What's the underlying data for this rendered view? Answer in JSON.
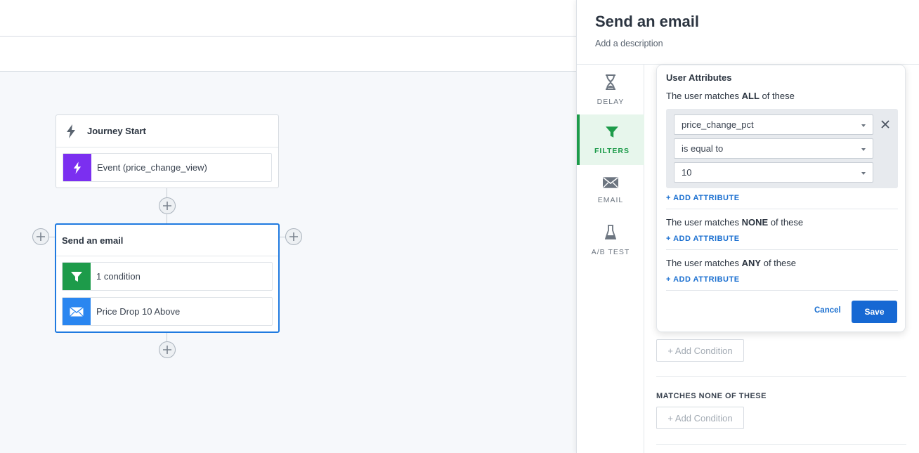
{
  "canvas": {
    "start_node": {
      "title": "Journey Start",
      "event_label": "Event (price_change_view)"
    },
    "email_node": {
      "title": "Send an email",
      "condition_label": "1 condition",
      "message_label": "Price Drop 10 Above"
    }
  },
  "panel": {
    "title": "Send an email",
    "description": "Add a description",
    "nav": [
      {
        "label": "DELAY",
        "icon": "hourglass-icon"
      },
      {
        "label": "FILTERS",
        "icon": "funnel-icon"
      },
      {
        "label": "EMAIL",
        "icon": "envelope-icon"
      },
      {
        "label": "A/B TEST",
        "icon": "beaker-icon"
      }
    ],
    "popup": {
      "title": "User Attributes",
      "all_prefix": "The user matches ",
      "all_bold": "ALL",
      "all_suffix": " of these",
      "none_prefix": "The user matches ",
      "none_bold": "NONE",
      "none_suffix": " of these",
      "any_prefix": "The user matches ",
      "any_bold": "ANY",
      "any_suffix": " of these",
      "attribute": "price_change_pct",
      "operator": "is equal to",
      "value": "10",
      "add_attribute": "+ ADD ATTRIBUTE",
      "cancel": "Cancel",
      "save": "Save"
    },
    "add_condition": "+ Add Condition",
    "matches_none_label": "MATCHES NONE OF THESE"
  },
  "colors": {
    "accent_blue": "#1668d3",
    "filters_green": "#1d9b4a",
    "event_purple": "#7b2ff0",
    "email_blue": "#2a86f0"
  }
}
